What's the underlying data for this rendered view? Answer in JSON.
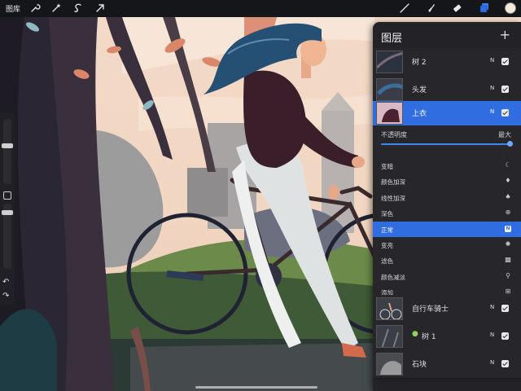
{
  "toolbar": {
    "gallery_label": "图库",
    "left_icons": [
      "wrench-icon",
      "magic-wand-icon",
      "selection-icon",
      "transform-arrow-icon"
    ],
    "right_icons": [
      "brush-icon",
      "smudge-icon",
      "eraser-icon",
      "layers-icon"
    ],
    "current_color": "#f2ebdc"
  },
  "layers_panel": {
    "title": "图层",
    "add_symbol": "+",
    "layers_top": [
      {
        "name": "树 2",
        "mode": "N",
        "visible": true,
        "active": false
      },
      {
        "name": "头发",
        "mode": "N",
        "visible": true,
        "active": false
      },
      {
        "name": "上衣",
        "mode": "N",
        "visible": true,
        "active": true
      }
    ],
    "opacity": {
      "label": "不透明度",
      "max_label": "最大",
      "value_percent": 100
    },
    "blend_modes": [
      {
        "name": "变暗",
        "icon": "moon-icon",
        "selected": false
      },
      {
        "name": "颜色加深",
        "icon": "flame-icon",
        "selected": false
      },
      {
        "name": "线性加深",
        "icon": "drop-icon",
        "selected": false
      },
      {
        "name": "深色",
        "icon": "circle-plus-icon",
        "selected": false
      },
      {
        "name": "正常",
        "icon": "n-icon",
        "selected": true
      },
      {
        "name": "变亮",
        "icon": "sun-icon",
        "selected": false
      },
      {
        "name": "滤色",
        "icon": "checker-icon",
        "selected": false
      },
      {
        "name": "颜色减淡",
        "icon": "dropper-icon",
        "selected": false
      },
      {
        "name": "添加",
        "icon": "plus-box-icon",
        "selected": false
      }
    ],
    "layers_bottom": [
      {
        "name": "自行车骑士",
        "mode": "N",
        "visible": true
      },
      {
        "name": "树 1",
        "mode": "N",
        "visible": true
      },
      {
        "name": "石块",
        "mode": "N",
        "visible": true
      }
    ]
  },
  "colors": {
    "accent": "#2f6de0",
    "panel_bg": "#222227",
    "toolbar_bg": "#15161a"
  }
}
